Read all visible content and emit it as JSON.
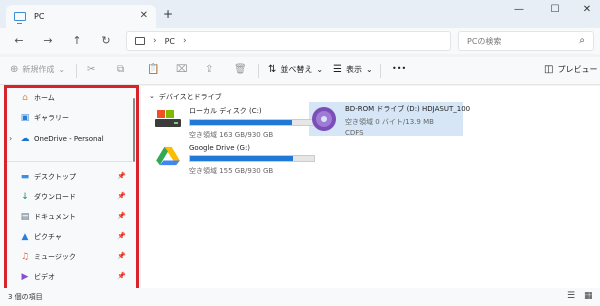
{
  "tab": {
    "title": "PC",
    "close": "✕"
  },
  "new_tab": "+",
  "window": {
    "minimize": "—",
    "maximize": "☐",
    "close": "✕"
  },
  "nav": {
    "back": "←",
    "forward": "→",
    "up": "↑",
    "refresh": "↻"
  },
  "address": {
    "segment": "PC",
    "chevron": "›"
  },
  "search": {
    "placeholder": "PCの検索",
    "icon": "⌕"
  },
  "commands": {
    "new": "新規作成",
    "new_arrow": "⌄",
    "sort": "並べ替え",
    "view": "表示",
    "more": "•••",
    "preview": "プレビュー"
  },
  "sidebar": {
    "items": [
      {
        "label": "ホーム",
        "icon": "home-icon"
      },
      {
        "label": "ギャラリー",
        "icon": "gallery-icon"
      },
      {
        "label": "OneDrive - Personal",
        "icon": "onedrive-icon"
      },
      {
        "label": "デスクトップ",
        "icon": "desktop-icon",
        "pinned": true
      },
      {
        "label": "ダウンロード",
        "icon": "download-icon",
        "pinned": true
      },
      {
        "label": "ドキュメント",
        "icon": "documents-icon",
        "pinned": true
      },
      {
        "label": "ピクチャ",
        "icon": "pictures-icon",
        "pinned": true
      },
      {
        "label": "ミュージック",
        "icon": "music-icon",
        "pinned": true
      },
      {
        "label": "ビデオ",
        "icon": "videos-icon",
        "pinned": true
      }
    ],
    "pin_glyph": "📌",
    "expand_glyph": "›"
  },
  "main": {
    "group_title": "デバイスとドライブ",
    "group_chevron": "⌄",
    "drives": [
      {
        "name": "ローカル ディスク (C:)",
        "free": "空き領域 163 GB/930 GB",
        "used_fraction": 0.82
      },
      {
        "name": "Google Drive (G:)",
        "free": "空き領域 155 GB/930 GB",
        "used_fraction": 0.83
      },
      {
        "name": "BD-ROM ドライブ (D:) HDJASUT_100",
        "free": "空き領域 0 バイト/13.9 MB",
        "fs": "CDFS"
      }
    ]
  },
  "status": {
    "count": "3 個の項目"
  },
  "colors": {
    "accent": "#2179d7",
    "highlight": "#d8232a",
    "selected": "#d6e6f6"
  }
}
